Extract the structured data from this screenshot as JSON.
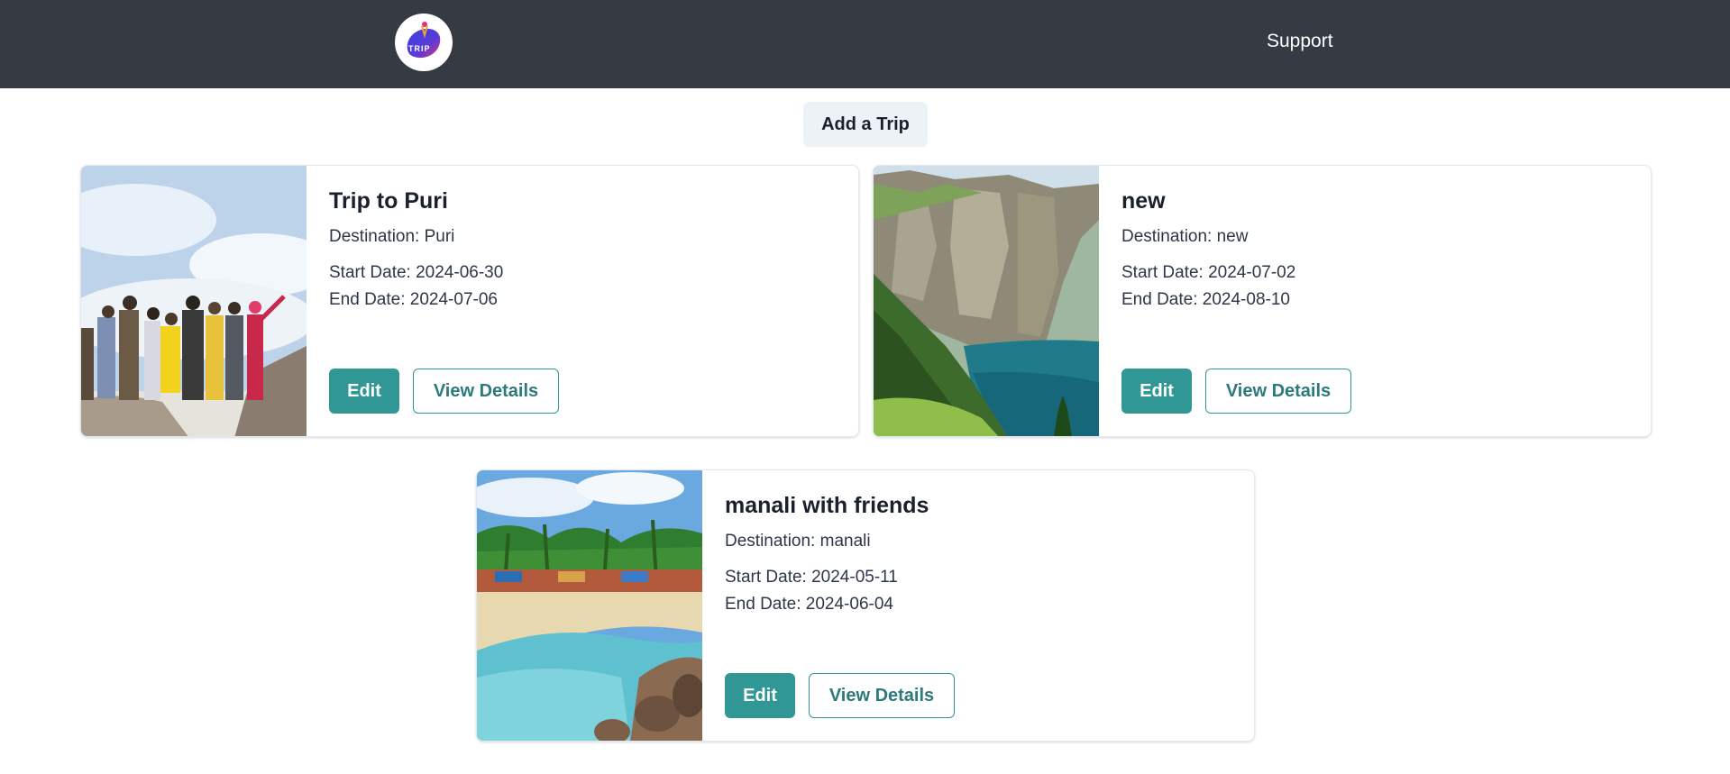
{
  "navbar": {
    "logo_text": "TRIP",
    "support_label": "Support"
  },
  "actions": {
    "add_trip_label": "Add a Trip"
  },
  "trips": [
    {
      "title": "Trip to Puri",
      "destination": "Destination: Puri",
      "start_date": "Start Date: 2024-06-30",
      "end_date": "End Date: 2024-07-06",
      "edit_label": "Edit",
      "details_label": "View Details",
      "image_subject": "group-of-friends-mountain-photo"
    },
    {
      "title": "new",
      "destination": "Destination: new",
      "start_date": "Start Date: 2024-07-02",
      "end_date": "End Date: 2024-08-10",
      "edit_label": "Edit",
      "details_label": "View Details",
      "image_subject": "cliff-lake-photo"
    },
    {
      "title": "manali with friends",
      "destination": "Destination: manali",
      "start_date": "Start Date: 2024-05-11",
      "end_date": "End Date: 2024-06-04",
      "edit_label": "Edit",
      "details_label": "View Details",
      "image_subject": "tropical-beach-photo"
    }
  ],
  "colors": {
    "navbar_bg": "#363a43",
    "accent": "#319795",
    "add_button_bg": "#edf2f7"
  }
}
